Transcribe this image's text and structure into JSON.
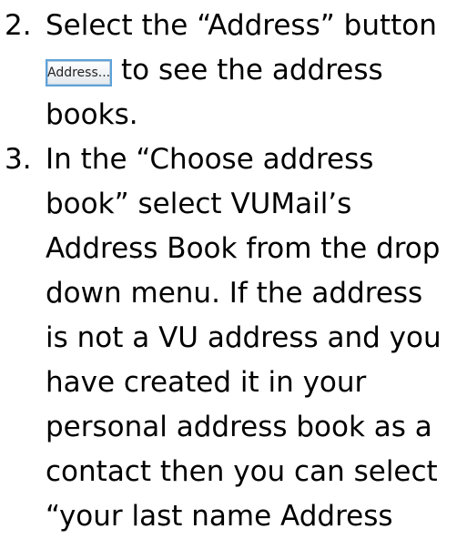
{
  "steps": [
    {
      "number": "2.",
      "line1": "Select the “Address” button",
      "button_label": "Address...",
      "after_button": "to see the address",
      "line3": "books."
    },
    {
      "number": "3.",
      "lines": [
        "In the “Choose address",
        "book” select VUMail’s",
        "Address Book from the drop",
        "down menu. If the address",
        "is not a VU address and you",
        "have created it in your",
        "personal address book as a",
        "contact then you can select",
        "“your last name Address"
      ]
    }
  ]
}
